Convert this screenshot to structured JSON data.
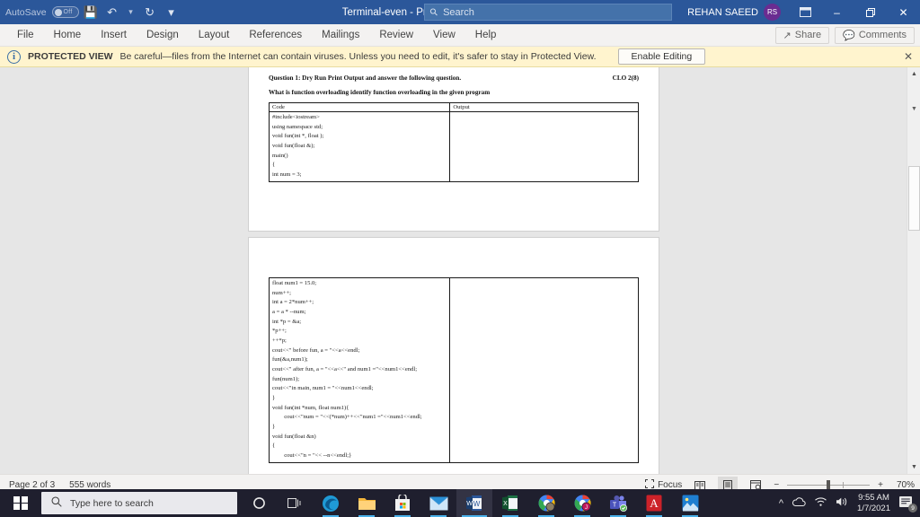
{
  "titlebar": {
    "autosave_label": "AutoSave",
    "autosave_state": "Off",
    "save_icon": "save-icon",
    "undo_icon": "undo-icon",
    "redo_icon": "redo-icon",
    "customize_icon": "customize-quick-access-icon",
    "document_title": "Terminal-even  -  Protected View  -  Saved to this PC",
    "title_caret": "▾",
    "search_placeholder": "Search",
    "user_name": "REHAN SAEED",
    "user_initials": "RS",
    "ribbon_display_icon": "ribbon-display-options-icon",
    "minimize": "–",
    "restore": "❐",
    "close": "✕"
  },
  "ribbon": {
    "tabs": [
      {
        "label": "File"
      },
      {
        "label": "Home"
      },
      {
        "label": "Insert"
      },
      {
        "label": "Design"
      },
      {
        "label": "Layout"
      },
      {
        "label": "References"
      },
      {
        "label": "Mailings"
      },
      {
        "label": "Review"
      },
      {
        "label": "View"
      },
      {
        "label": "Help"
      }
    ],
    "share_label": "Share",
    "comments_label": "Comments"
  },
  "protected_view": {
    "icon": "info-icon",
    "title": "PROTECTED VIEW",
    "message": "Be careful—files from the Internet can contain viruses. Unless you need to edit, it's safer to stay in Protected View.",
    "enable_label": "Enable Editing",
    "close_label": "✕"
  },
  "document": {
    "page1": {
      "question_title": "Question 1: Dry Run Print Output and answer the following question.",
      "clo": "CLO 2(8)",
      "question_sub": "What is function overloading identify function overloading in the given program",
      "table_headers": [
        "Code",
        "Output"
      ],
      "code_lines": [
        "#include<iostream>",
        "using namespace std;",
        "void fun(int *, float );",
        "void fun(float &);",
        "main()",
        "{",
        "int num = 3;"
      ],
      "output_lines": []
    },
    "page2": {
      "code_lines": [
        "float num1 = 15.0;",
        "num++;",
        "int a = 2*num++;",
        "a = a * --num;",
        "int *p = &a;",
        "*p++;",
        "++*p;",
        "cout<<\" before fun, a = \"<<a<<endl;",
        "fun(&a,num1);",
        "cout<<\" after fun, a = \"<<a<<\" and num1 =\"<<num1<<endl;",
        "fun(num1);",
        "cout<<\"in main, num1 = \"<<num1<<endl;",
        "}",
        "void fun(int *num, float num1){",
        "        cout<<\"num = \"<<(*num)++<<\"num1 =\"<<num1<<endl;",
        "}",
        "void fun(float &n)",
        "{",
        "        cout<<\"n = \"<< --n<<endl;}"
      ],
      "output_lines": []
    }
  },
  "statusbar": {
    "page_label": "Page 2 of 3",
    "word_count": "555 words",
    "focus_label": "Focus",
    "view_read_icon": "read-mode-icon",
    "view_print_icon": "print-layout-icon",
    "view_web_icon": "web-layout-icon",
    "zoom_out": "−",
    "zoom_in": "+",
    "zoom_level": "70%"
  },
  "taskbar": {
    "start_icon": "windows-start-icon",
    "search_placeholder": "Type here to search",
    "cortana_icon": "cortana-icon",
    "taskview_icon": "task-view-icon",
    "apps": [
      {
        "name": "microsoft-edge",
        "color": "#2a8fd6",
        "glyph": "e"
      },
      {
        "name": "file-explorer",
        "color": "#ffb900",
        "glyph": "📁"
      },
      {
        "name": "microsoft-store",
        "color": "#f3f3f3",
        "glyph": "🛎"
      },
      {
        "name": "mail",
        "color": "#1a7ecb",
        "glyph": "✉"
      },
      {
        "name": "microsoft-word",
        "color": "#2b579a",
        "glyph": "W"
      },
      {
        "name": "microsoft-excel",
        "color": "#1e7145",
        "glyph": "X"
      },
      {
        "name": "google-chrome-profile-1",
        "color": "#4285f4",
        "glyph": ""
      },
      {
        "name": "google-chrome-profile-2",
        "color": "#4285f4",
        "glyph": ""
      },
      {
        "name": "microsoft-teams",
        "color": "#5558af",
        "glyph": "T"
      },
      {
        "name": "adobe-acrobat",
        "color": "#cc2229",
        "glyph": "A"
      },
      {
        "name": "photos",
        "color": "#2a8fd6",
        "glyph": "🏞"
      }
    ],
    "tray": {
      "show_hidden_icon": "chevron-up-icon",
      "onedrive_icon": "onedrive-icon",
      "network_icon": "wifi-icon",
      "volume_icon": "speaker-icon",
      "time": "9:55 AM",
      "date": "1/7/2021",
      "notifications_icon": "action-center-icon",
      "notifications_count": "9"
    }
  },
  "scrollbar": {
    "up_arrow": "▲",
    "down_arrow": "▼",
    "split_handle": "▼"
  }
}
